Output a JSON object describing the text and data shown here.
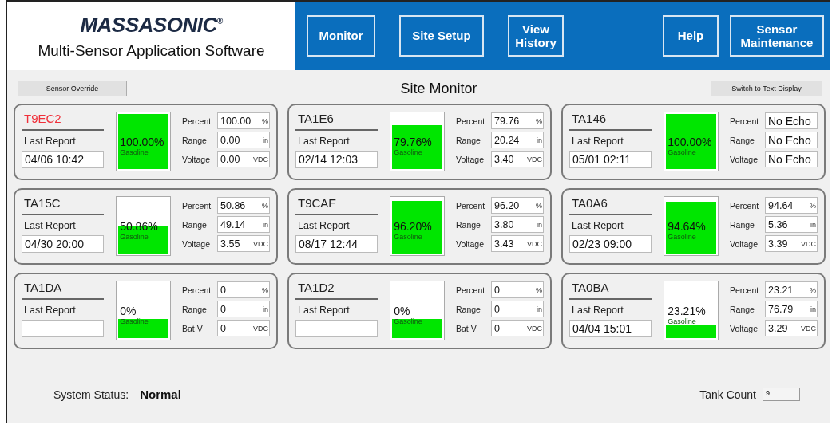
{
  "header": {
    "logo": "MASSASONIC$^{®}$",
    "subtitle": "Multi-Sensor Application Software",
    "nav": [
      {
        "label": "Monitor"
      },
      {
        "label": "Site Setup"
      },
      {
        "label": "View History"
      },
      {
        "label": "Help"
      },
      {
        "label": "Sensor Maintenance"
      }
    ]
  },
  "toolbar": {
    "left_button": "Sensor Override",
    "title": "Site Monitor",
    "right_button": "Switch to Text Display"
  },
  "tanks": [
    {
      "name": "T9EC2",
      "alarm": true,
      "last_report_label": "Last Report",
      "last_report": "04/06  10:42",
      "level": 1.0,
      "gauge_text": "100.00%",
      "product": "Gasoline",
      "readings": [
        {
          "label": "Percent",
          "value": "100.00",
          "unit": "%"
        },
        {
          "label": "Range",
          "value": "0.00",
          "unit": "in"
        },
        {
          "label": "Voltage",
          "value": "0.00",
          "unit": "VDC"
        }
      ]
    },
    {
      "name": "TA1E6",
      "alarm": false,
      "last_report_label": "Last Report",
      "last_report": "02/14  12:03",
      "level": 0.7976,
      "gauge_text": "79.76%",
      "product": "Gasoline",
      "readings": [
        {
          "label": "Percent",
          "value": "79.76",
          "unit": "%"
        },
        {
          "label": "Range",
          "value": "20.24",
          "unit": "in"
        },
        {
          "label": "Voltage",
          "value": "3.40",
          "unit": "VDC"
        }
      ]
    },
    {
      "name": "TA146",
      "alarm": false,
      "last_report_label": "Last Report",
      "last_report": "05/01  02:11",
      "level": 1.0,
      "gauge_text": "100.00%",
      "product": "Gasoline",
      "readings": [
        {
          "label": "Percent",
          "value": "No Echo"
        },
        {
          "label": "Range",
          "value": "No Echo"
        },
        {
          "label": "Voltage",
          "value": "No Echo"
        }
      ]
    },
    {
      "name": "TA15C",
      "alarm": false,
      "last_report_label": "Last Report",
      "last_report": "04/30  20:00",
      "level": 0.5086,
      "gauge_text": "50.86%",
      "product": "Gasoline",
      "readings": [
        {
          "label": "Percent",
          "value": "50.86",
          "unit": "%"
        },
        {
          "label": "Range",
          "value": "49.14",
          "unit": "in"
        },
        {
          "label": "Voltage",
          "value": "3.55",
          "unit": "VDC"
        }
      ]
    },
    {
      "name": "T9CAE",
      "alarm": false,
      "last_report_label": "Last Report",
      "last_report": "08/17  12:44",
      "level": 0.962,
      "gauge_text": "96.20%",
      "product": "Gasoline",
      "readings": [
        {
          "label": "Percent",
          "value": "96.20",
          "unit": "%"
        },
        {
          "label": "Range",
          "value": "3.80",
          "unit": "in"
        },
        {
          "label": "Voltage",
          "value": "3.43",
          "unit": "VDC"
        }
      ]
    },
    {
      "name": "TA0A6",
      "alarm": false,
      "last_report_label": "Last Report",
      "last_report": "02/23  09:00",
      "level": 0.9464,
      "gauge_text": "94.64%",
      "product": "Gasoline",
      "readings": [
        {
          "label": "Percent",
          "value": "94.64",
          "unit": "%"
        },
        {
          "label": "Range",
          "value": "5.36",
          "unit": "in"
        },
        {
          "label": "Voltage",
          "value": "3.39",
          "unit": "VDC"
        }
      ]
    },
    {
      "name": "TA1DA",
      "alarm": false,
      "last_report_label": "Last Report",
      "level": 0.35,
      "gauge_text": "0%",
      "product": "Gasoline",
      "readings": [
        {
          "label": "Percent",
          "value": "0",
          "unit": "%"
        },
        {
          "label": "Range",
          "value": "0",
          "unit": "in"
        },
        {
          "label": "Bat V",
          "value": "0",
          "unit": "VDC"
        }
      ]
    },
    {
      "name": "TA1D2",
      "alarm": false,
      "last_report_label": "Last Report",
      "level": 0.35,
      "gauge_text": "0%",
      "product": "Gasoline",
      "readings": [
        {
          "label": "Percent",
          "value": "0",
          "unit": "%"
        },
        {
          "label": "Range",
          "value": "0",
          "unit": "in"
        },
        {
          "label": "Bat V",
          "value": "0",
          "unit": "VDC"
        }
      ]
    },
    {
      "name": "TA0BA",
      "alarm": false,
      "last_report_label": "Last Report",
      "last_report": "04/04  15:01",
      "level": 0.2321,
      "gauge_text": "23.21%",
      "product": "Gasoline",
      "readings": [
        {
          "label": "Percent",
          "value": "23.21",
          "unit": "%"
        },
        {
          "label": "Range",
          "value": "76.79",
          "unit": "in"
        },
        {
          "label": "Voltage",
          "value": "3.29",
          "unit": "VDC"
        }
      ]
    }
  ],
  "status_bar": {
    "status_label": "System Status:",
    "status": "Normal",
    "count_label": "Tank Count",
    "count": "9"
  }
}
